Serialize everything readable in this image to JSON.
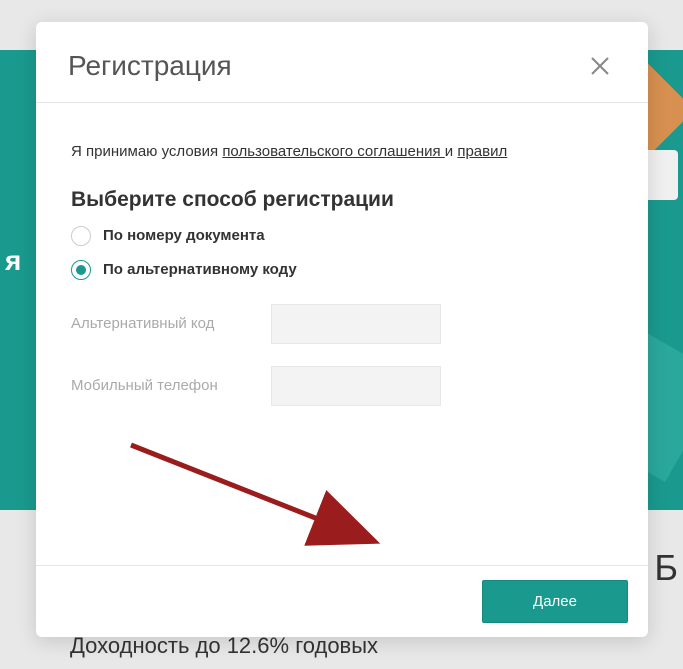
{
  "modal": {
    "title": "Регистрация",
    "terms": {
      "prefix": "Я принимаю условия ",
      "link1": "пользовательского соглашения ",
      "mid": "и ",
      "link2": "правил"
    },
    "section_title": "Выберите способ регистрации",
    "radio": {
      "option1": "По номеру документа",
      "option2": "По альтернативному коду"
    },
    "fields": {
      "alt_code_label": "Альтернативный код",
      "alt_code_value": "",
      "phone_label": "Мобильный телефон",
      "phone_value": ""
    },
    "next_button": "Далее"
  },
  "background": {
    "left_text": "я",
    "right_text": "Б",
    "bottom_text": "Доходность до 12.6% годовых"
  }
}
